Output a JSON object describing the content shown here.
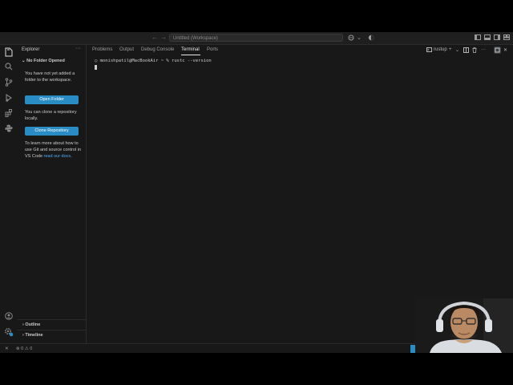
{
  "titlebar": {
    "back": "←",
    "forward": "→",
    "workspace_title": "Untitled (Workspace)"
  },
  "sidebar": {
    "header": "Explorer",
    "more": "···",
    "section_title": "No Folder Opened",
    "message": "You have not yet added a folder to the workspace.",
    "open_folder_label": "Open Folder",
    "clone_message": "You can clone a repository locally.",
    "clone_label": "Clone Repository",
    "learn_text": "To learn more about how to use Git and source control in VS Code ",
    "learn_link": "read our docs",
    "learn_end": ".",
    "outline_label": "Outline",
    "timeline_label": "Timeline"
  },
  "panel": {
    "tabs": [
      {
        "label": "Problems"
      },
      {
        "label": "Output"
      },
      {
        "label": "Debug Console"
      },
      {
        "label": "Terminal"
      },
      {
        "label": "Ports"
      }
    ],
    "terminal_name": "rustup",
    "prompt_line": "monishpatil@MacBookAir ~ % rustc --version"
  },
  "statusbar": {
    "remote": "✕",
    "errors": "0",
    "warnings": "0"
  }
}
